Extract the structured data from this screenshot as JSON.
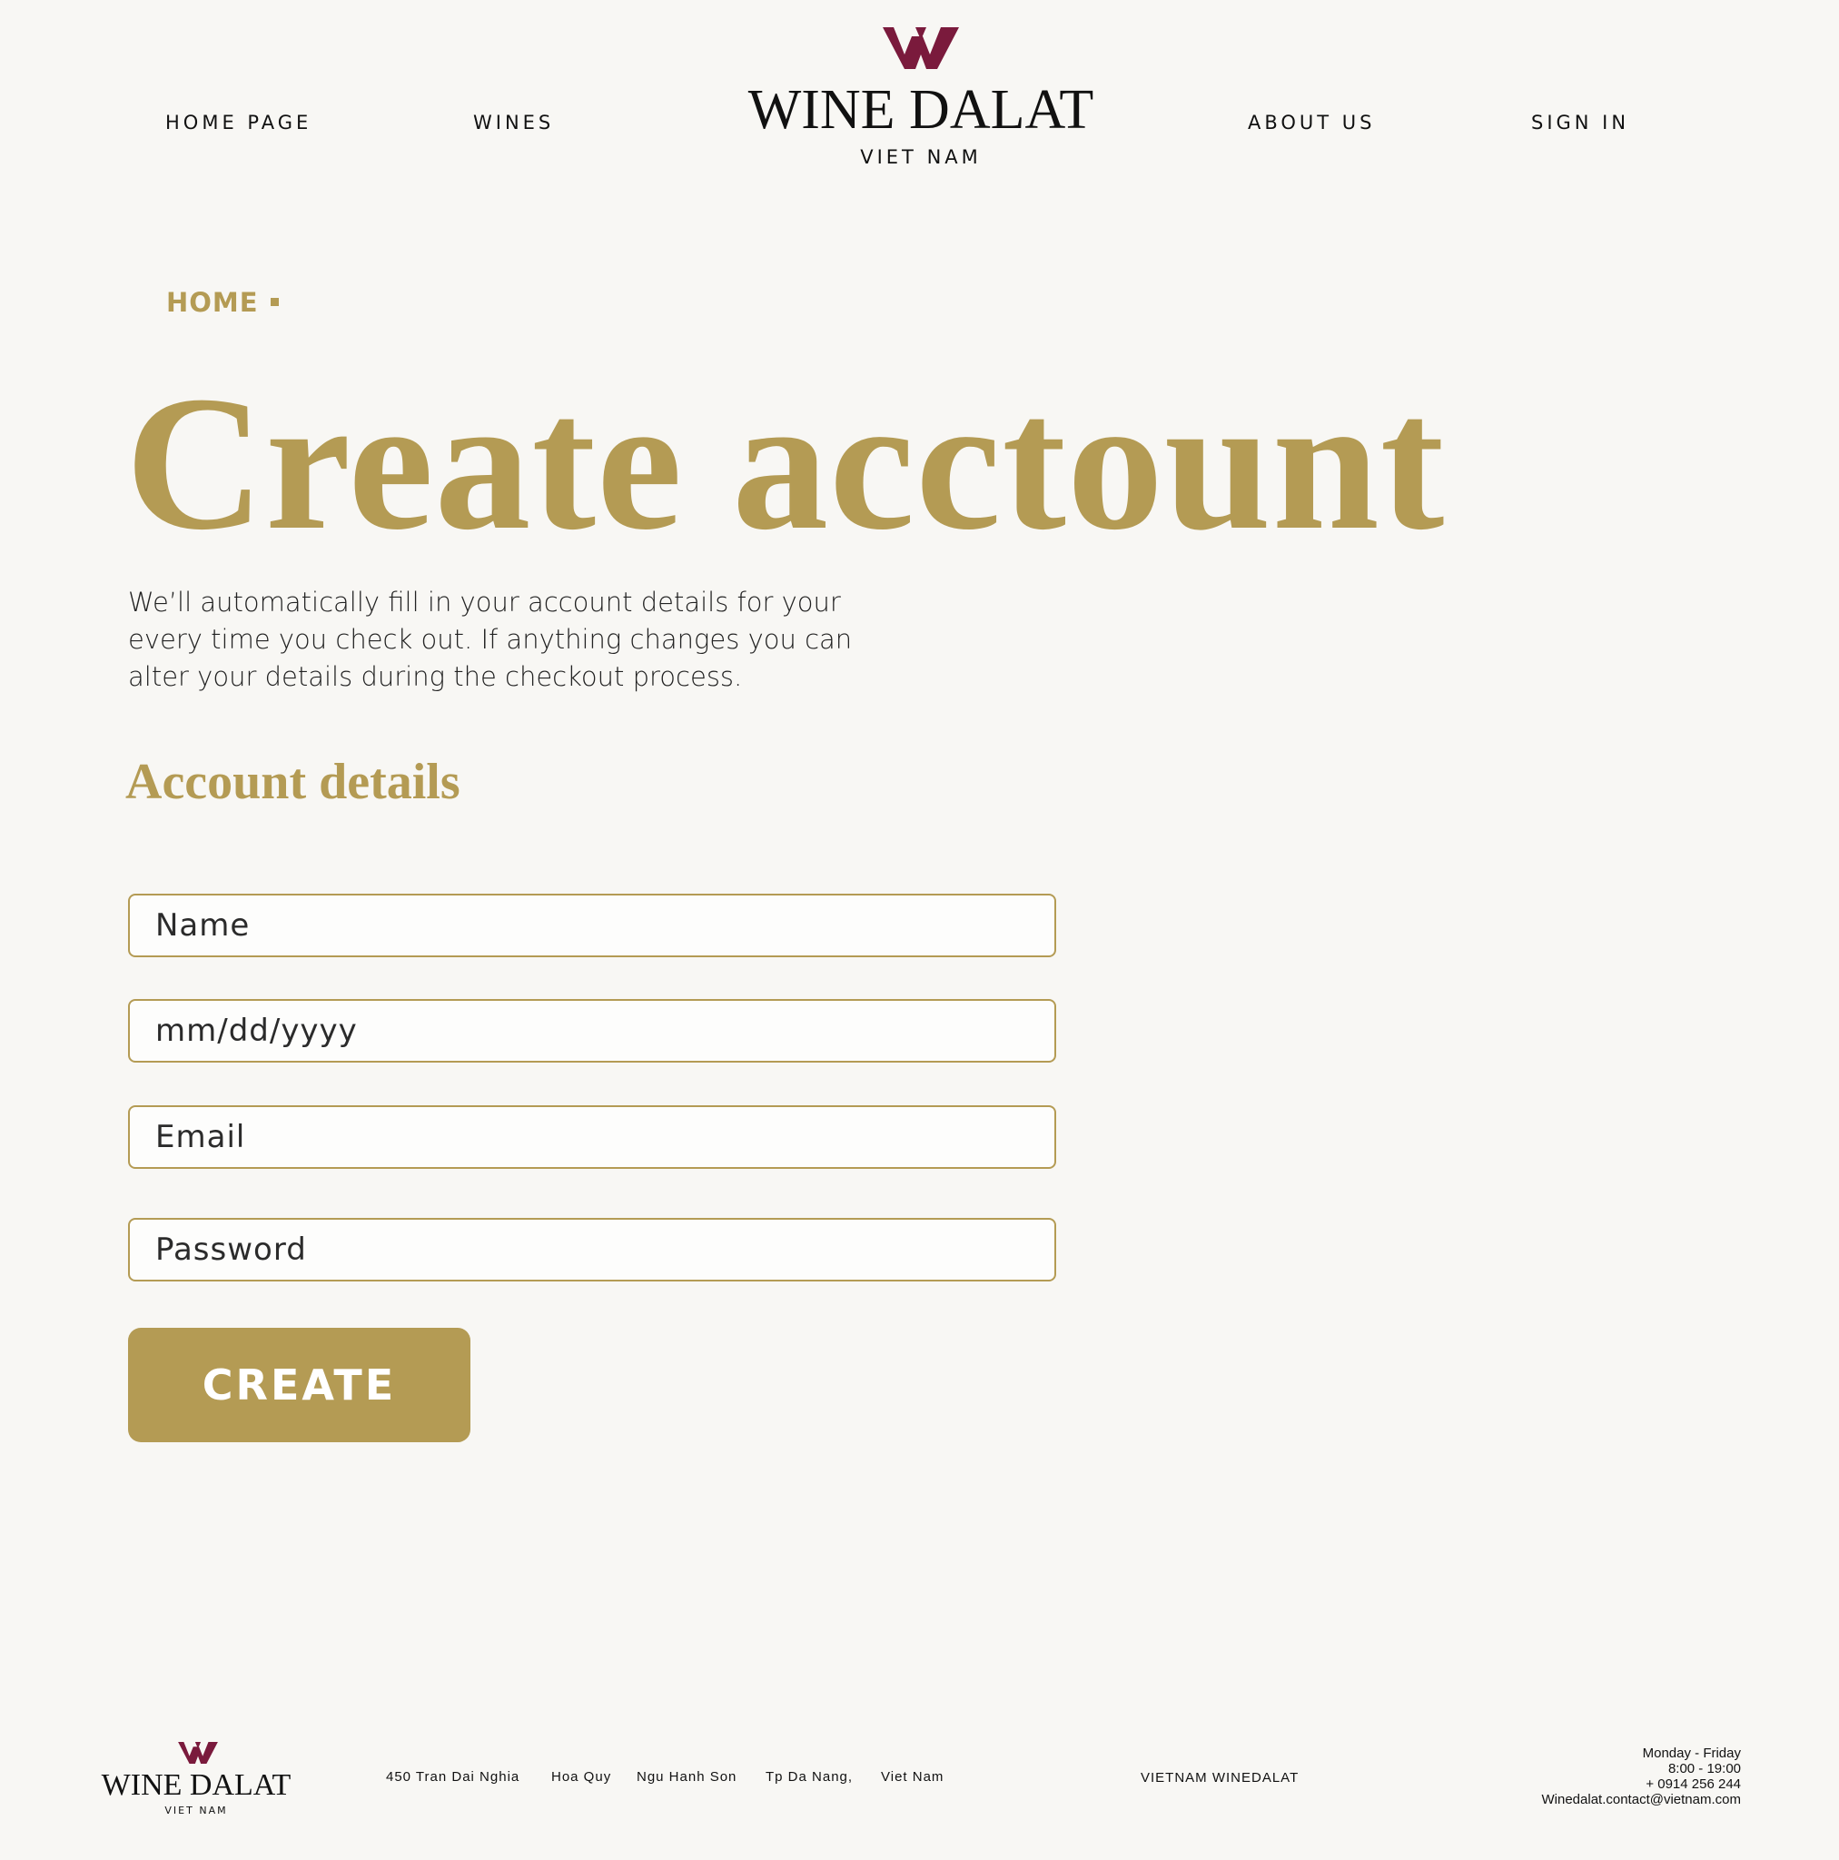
{
  "brand": {
    "name": "WINE DALAT",
    "sub": "VIET NAM",
    "accent_color": "#b49b54",
    "mark_color": "#7a1a3c"
  },
  "nav": {
    "home": "HOME PAGE",
    "wines": "WINES",
    "about": "ABOUT US",
    "signin": "SIGN IN"
  },
  "breadcrumb": {
    "home": "HOME"
  },
  "page": {
    "title": "Create acctount",
    "intro": "We’ll automatically fill in your account details for your every time you check out. If anything changes you can alter your details during the checkout process.",
    "section_title": "Account details"
  },
  "form": {
    "name_placeholder": "Name",
    "dob_placeholder": "mm/dd/yyyy",
    "email_placeholder": "Email",
    "password_placeholder": "Password",
    "submit_label": "CREATE"
  },
  "footer": {
    "address": [
      "450 Tran Dai Nghia",
      "Hoa Quy",
      "Ngu Hanh Son",
      "Tp Da Nang,",
      "Viet Nam"
    ],
    "company": "VIETNAM WINEDALAT",
    "hours_days": "Monday - Friday",
    "hours_time": "8:00 - 19:00",
    "phone": "+ 0914 256 244",
    "email": "Winedalat.contact@vietnam.com"
  }
}
